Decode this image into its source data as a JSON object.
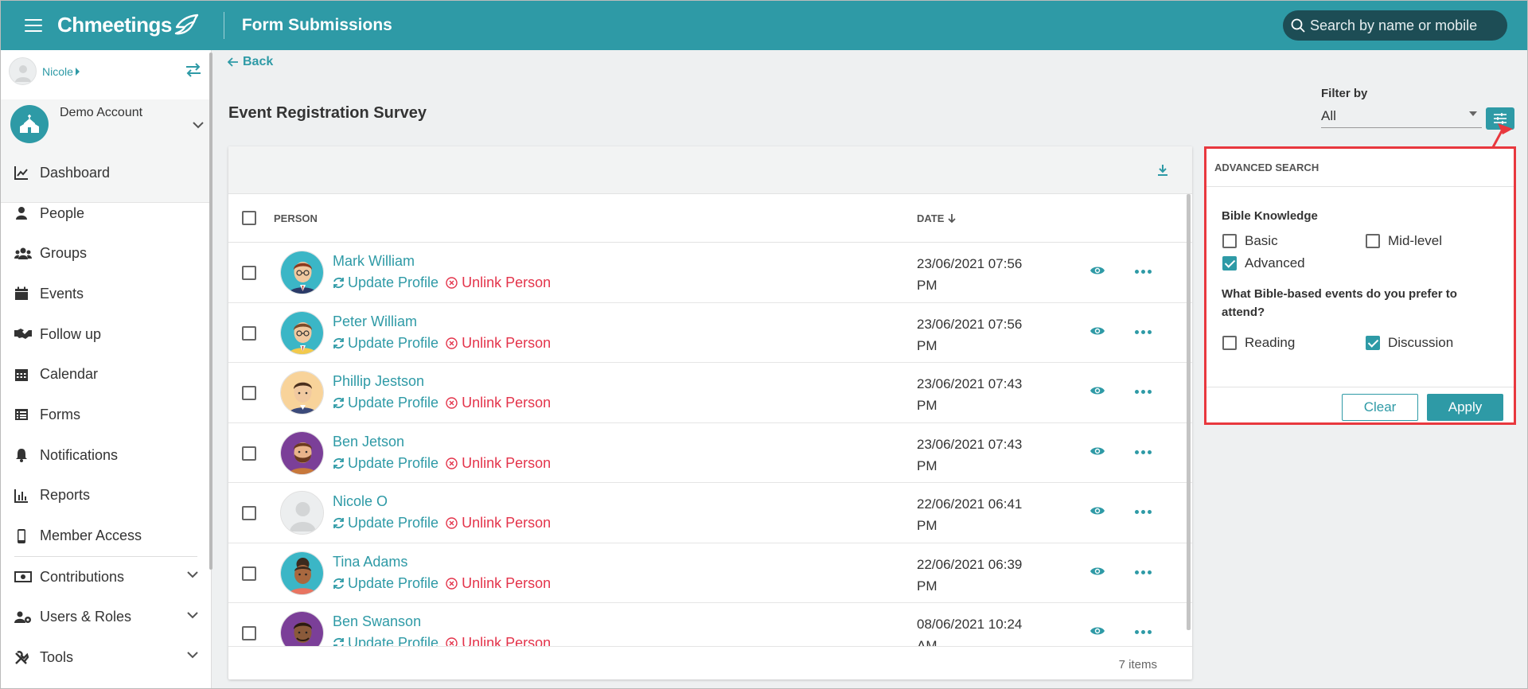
{
  "app": {
    "brand": "Chmeetings",
    "page_title": "Form Submissions"
  },
  "search": {
    "placeholder": "Search by name or mobile"
  },
  "sidebar": {
    "user": "Nicole",
    "account": "Demo Account",
    "items": [
      {
        "label": "Dashboard",
        "icon": "chart-line-icon"
      },
      {
        "label": "People",
        "icon": "person-icon"
      },
      {
        "label": "Groups",
        "icon": "users-icon"
      },
      {
        "label": "Events",
        "icon": "calendar-icon"
      },
      {
        "label": "Follow up",
        "icon": "handshake-icon"
      },
      {
        "label": "Calendar",
        "icon": "calendar-grid-icon"
      },
      {
        "label": "Forms",
        "icon": "list-icon"
      },
      {
        "label": "Notifications",
        "icon": "bell-icon"
      },
      {
        "label": "Reports",
        "icon": "bar-chart-icon"
      },
      {
        "label": "Member Access",
        "icon": "mobile-icon"
      },
      {
        "label": "Contributions",
        "icon": "money-icon"
      },
      {
        "label": "Users & Roles",
        "icon": "users-cog-icon"
      },
      {
        "label": "Tools",
        "icon": "tools-icon"
      }
    ]
  },
  "main": {
    "back": "Back",
    "survey_title": "Event Registration Survey",
    "filter": {
      "label": "Filter by",
      "value": "All"
    }
  },
  "table": {
    "columns": {
      "person": "PERSON",
      "date": "DATE"
    },
    "update_label": "Update Profile",
    "unlink_label": "Unlink Person",
    "rows": [
      {
        "name": "Mark William",
        "date": "23/06/2021 07:56",
        "ampm": "PM"
      },
      {
        "name": "Peter William",
        "date": "23/06/2021 07:56",
        "ampm": "PM"
      },
      {
        "name": "Phillip Jestson",
        "date": "23/06/2021 07:43",
        "ampm": "PM"
      },
      {
        "name": "Ben Jetson",
        "date": "23/06/2021 07:43",
        "ampm": "PM"
      },
      {
        "name": "Nicole O",
        "date": "22/06/2021 06:41",
        "ampm": "PM"
      },
      {
        "name": "Tina Adams",
        "date": "22/06/2021 06:39",
        "ampm": "PM"
      },
      {
        "name": "Ben Swanson",
        "date": "08/06/2021 10:24",
        "ampm": "AM"
      }
    ],
    "items_count": "7 items"
  },
  "advanced_search": {
    "title": "ADVANCED SEARCH",
    "q1": "Bible Knowledge",
    "q1_options": [
      {
        "label": "Basic",
        "checked": false
      },
      {
        "label": "Mid-level",
        "checked": false
      },
      {
        "label": "Advanced",
        "checked": true
      }
    ],
    "q2": "What Bible-based events do you prefer to attend?",
    "q2_options": [
      {
        "label": "Reading",
        "checked": false
      },
      {
        "label": "Discussion",
        "checked": true
      }
    ],
    "clear": "Clear",
    "apply": "Apply"
  },
  "colors": {
    "primary": "#2e9aa6",
    "danger": "#e3344b",
    "highlight": "#e8383e",
    "search_bg": "#1d4d55"
  }
}
